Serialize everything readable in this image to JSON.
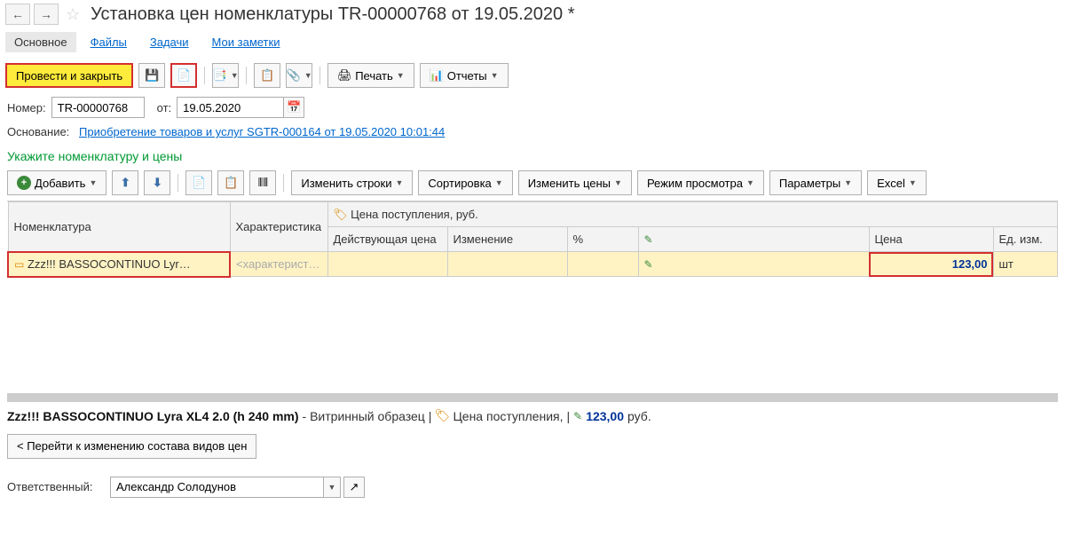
{
  "header": {
    "title": "Установка цен номенклатуры TR-00000768 от 19.05.2020 *"
  },
  "tabs": {
    "main": "Основное",
    "files": "Файлы",
    "tasks": "Задачи",
    "notes": "Мои заметки"
  },
  "toolbar": {
    "post_and_close": "Провести и закрыть",
    "print": "Печать",
    "reports": "Отчеты"
  },
  "form": {
    "number_label": "Номер:",
    "number_value": "TR-00000768",
    "from_label": "от:",
    "date_value": "19.05.2020",
    "basis_label": "Основание:",
    "basis_link": "Приобретение товаров и услуг SGTR-000164 от 19.05.2020 10:01:44"
  },
  "section_title": "Укажите номенклатуру и цены",
  "table_toolbar": {
    "add": "Добавить",
    "edit_rows": "Изменить строки",
    "sorting": "Сортировка",
    "edit_prices": "Изменить цены",
    "view_mode": "Режим просмотра",
    "parameters": "Параметры",
    "excel": "Excel"
  },
  "table": {
    "headers": {
      "nomenclature": "Номенклатура",
      "characteristic": "Характеристика",
      "price_group": "Цена поступления, руб.",
      "current_price": "Действующая цена",
      "change": "Изменение",
      "percent": "%",
      "price": "Цена",
      "unit": "Ед. изм."
    },
    "row": {
      "nomenclature": "Zzz!!! BASSOCONTINUO Lyr…",
      "characteristic_placeholder": "<характерист…",
      "price": "123,00",
      "unit": "шт"
    }
  },
  "status": {
    "item_name": "Zzz!!! BASSOCONTINUO Lyra XL4 2.0 (h 240 mm)",
    "suffix": " - Витринный образец",
    "price_type": "Цена поступления,",
    "price_value": "123,00",
    "currency": "руб."
  },
  "footer": {
    "goto_button": "< Перейти к изменению состава видов цен",
    "responsible_label": "Ответственный:",
    "responsible_value": "Александр Солодунов"
  }
}
